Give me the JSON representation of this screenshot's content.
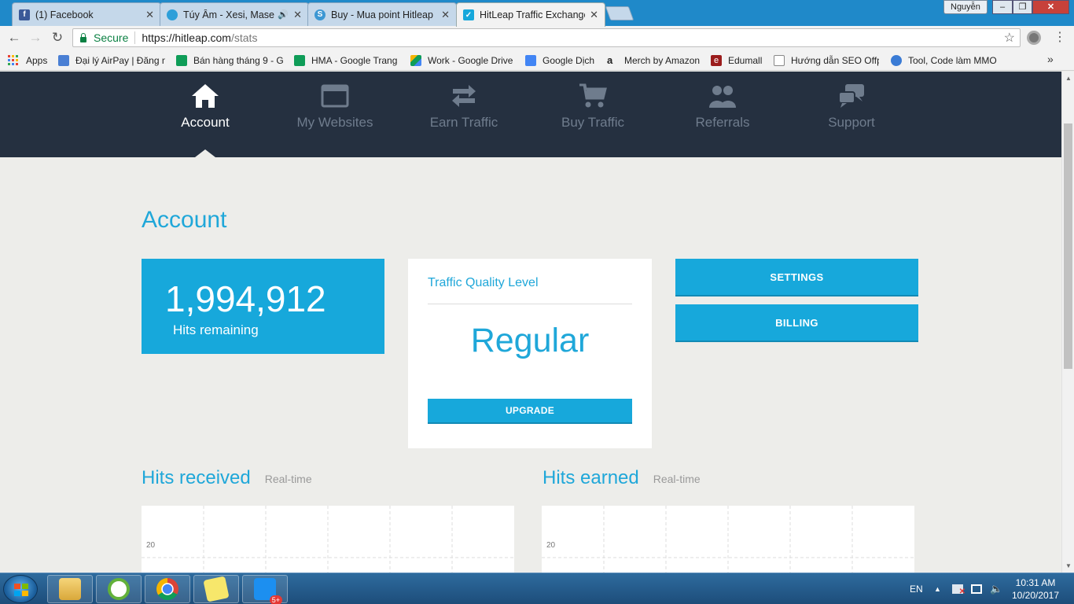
{
  "browser": {
    "tabs": [
      {
        "title": "(1) Facebook",
        "favicon": "facebook-icon",
        "color": "#3b5998",
        "glyph": "f",
        "active": false
      },
      {
        "title": "Túy Âm - Xesi, Masew",
        "favicon": "zing-mp3-icon",
        "color": "#2d9fd9",
        "glyph": "",
        "active": false,
        "audio": true
      },
      {
        "title": "Buy - Mua point Hitleap",
        "favicon": "skype-icon",
        "color": "#3c97d3",
        "glyph": "S",
        "active": false
      },
      {
        "title": "HitLeap Traffic Exchange",
        "favicon": "hitleap-icon",
        "color": "#17a8db",
        "glyph": "",
        "active": true
      }
    ],
    "profile_name": "Nguyễn",
    "address": {
      "secure_label": "Secure",
      "host": "https://hitleap.com",
      "path": "/stats"
    },
    "bookmarks": [
      {
        "label": "Apps",
        "icon": "apps-grid-icon"
      },
      {
        "label": "Đại lý AirPay | Đăng n",
        "icon": "airpay-icon",
        "color": "#4a7fd4"
      },
      {
        "label": "Bán hàng tháng 9 - G",
        "icon": "google-sheets-icon",
        "color": "#0f9d58"
      },
      {
        "label": "HMA - Google Trang",
        "icon": "google-sheets-icon",
        "color": "#0f9d58"
      },
      {
        "label": "Work - Google Drive",
        "icon": "google-drive-icon",
        "color": "#f4b400"
      },
      {
        "label": "Google Dịch",
        "icon": "google-translate-icon",
        "color": "#4285f4"
      },
      {
        "label": "Merch by Amazon",
        "icon": "amazon-icon",
        "color": "#222222"
      },
      {
        "label": "Edumall",
        "icon": "edumall-icon",
        "color": "#9b1c1c"
      },
      {
        "label": "Hướng dẫn SEO Offp",
        "icon": "document-icon",
        "color": "#888888"
      },
      {
        "label": "Tool, Code làm MMO",
        "icon": "tool-icon",
        "color": "#3a7bd5"
      }
    ]
  },
  "site_nav": [
    {
      "label": "Account",
      "icon": "home-icon",
      "active": true
    },
    {
      "label": "My Websites",
      "icon": "browser-window-icon",
      "active": false
    },
    {
      "label": "Earn Traffic",
      "icon": "exchange-arrows-icon",
      "active": false
    },
    {
      "label": "Buy Traffic",
      "icon": "shopping-cart-icon",
      "active": false
    },
    {
      "label": "Referrals",
      "icon": "users-icon",
      "active": false
    },
    {
      "label": "Support",
      "icon": "chat-bubbles-icon",
      "active": false
    }
  ],
  "account": {
    "title": "Account",
    "hits_remaining_value": "1,994,912",
    "hits_remaining_label": "Hits remaining",
    "quality_title": "Traffic Quality Level",
    "quality_level": "Regular",
    "upgrade_label": "UPGRADE",
    "settings_label": "SETTINGS",
    "billing_label": "BILLING"
  },
  "sections": {
    "received_title": "Hits received",
    "received_sub": "Real-time",
    "earned_title": "Hits earned",
    "earned_sub": "Real-time"
  },
  "chart_data": [
    {
      "type": "line",
      "title": "Hits received",
      "y_ticks": [
        "20"
      ]
    },
    {
      "type": "line",
      "title": "Hits earned",
      "y_ticks": [
        "20"
      ]
    }
  ],
  "taskbar": {
    "apps": [
      "file-explorer-icon",
      "coc-coc-browser-icon",
      "chrome-icon",
      "sticky-notes-icon",
      "zalo-icon"
    ],
    "zalo_badge": "5+",
    "language": "EN",
    "time": "10:31 AM",
    "date": "10/20/2017"
  },
  "colors": {
    "accent": "#17a8db",
    "nav_bg": "#253040",
    "page_bg": "#ededea"
  }
}
